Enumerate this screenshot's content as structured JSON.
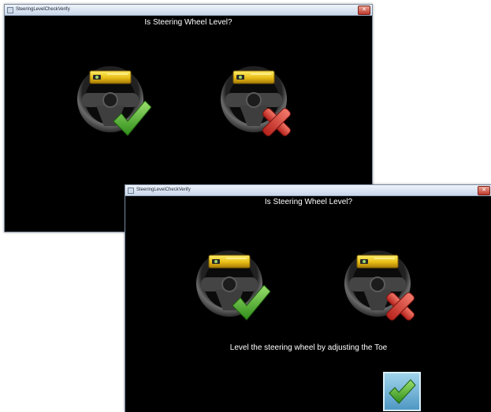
{
  "windows": [
    {
      "title": "SteeringLevelCheckVerify",
      "question": "Is Steering Wheel Level?",
      "close_glyph": "✕",
      "options": [
        {
          "icon": "steering-wheel-level-yes-icon",
          "mark": "green-check"
        },
        {
          "icon": "steering-wheel-level-no-icon",
          "mark": "red-x"
        }
      ]
    },
    {
      "title": "SteeringLevelCheckVerify",
      "question": "Is Steering Wheel Level?",
      "instruction": "Level the steering wheel by adjusting the Toe",
      "close_glyph": "✕",
      "options": [
        {
          "icon": "steering-wheel-level-yes-icon",
          "mark": "green-check"
        },
        {
          "icon": "steering-wheel-level-no-icon",
          "mark": "red-x"
        }
      ],
      "confirm_button": {
        "icon": "check-icon"
      }
    }
  ],
  "colors": {
    "level_yellow": "#e8bd16",
    "check_green": "#4cb02d",
    "cross_red": "#d8352b",
    "confirm_blue": "#4f98c4"
  }
}
